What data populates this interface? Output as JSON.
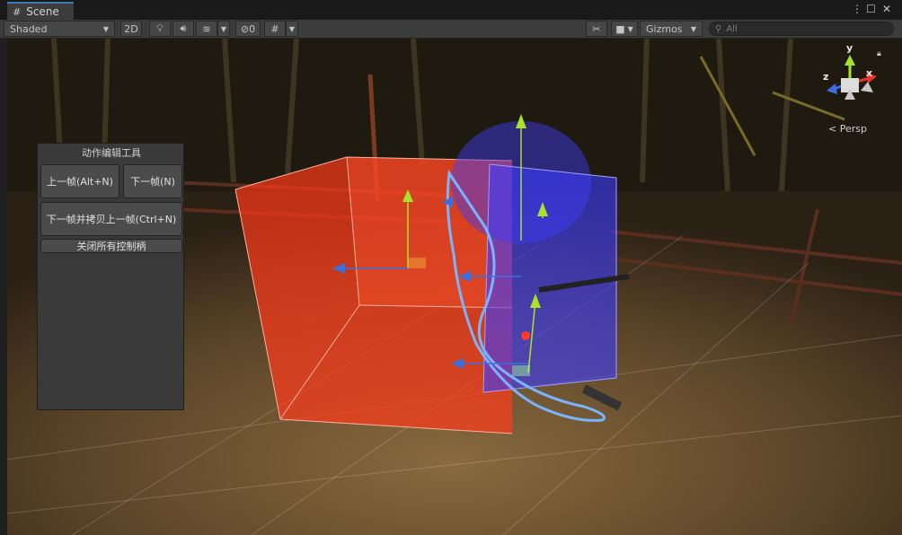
{
  "tab": {
    "title": "Scene"
  },
  "toolbar": {
    "shading_mode": "Shaded",
    "mode_2d": "2D",
    "hidden_count": "0",
    "gizmos_label": "Gizmos",
    "search_placeholder": "All"
  },
  "gizmo": {
    "y": "y",
    "x": "x",
    "z": "z",
    "projection": "< Persp"
  },
  "panel": {
    "title": "动作编辑工具",
    "prev_frame": "上一帧(Alt+N)",
    "next_frame": "下一帧(N)",
    "next_copy": "下一帧并拷贝上一帧(Ctrl+N)",
    "close_handles": "关闭所有控制柄"
  },
  "colors": {
    "accent": "#3a79bb",
    "red_box": "#ff3b1a",
    "blue_box": "#3c3cff",
    "gizmo_green": "#a8e22a",
    "gizmo_blue": "#3b6fe0"
  }
}
